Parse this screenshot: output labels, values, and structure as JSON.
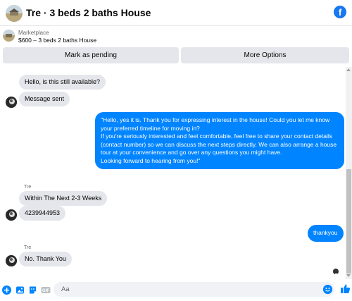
{
  "header": {
    "title": "Tre · 3 beds 2 baths House",
    "brand_icon": "facebook-icon",
    "brand_glyph": "f"
  },
  "marketplace": {
    "label": "Marketplace",
    "item": "$600 – 3 beds 2 baths House",
    "pending_button": "Mark as pending",
    "more_button": "More Options"
  },
  "messages": {
    "m1": "Hello, is this still available?",
    "m2": "Message sent",
    "m3": "\"Hello, yes it is. Thank you for expressing interest in the house! Could you let me know your preferred timeline for moving in?\nIf you're seriously interested and feel comfortable, feel free to share your contact details (contact number) so we can discuss the next steps directly. We can also arrange a house tour at your convenience and go over any questions you might have.\nLooking forward to hearing from you!\"",
    "sender1": "Tre",
    "m4": "Within The Next 2-3 Weeks",
    "m5": "4239944953",
    "m6": "thankyou",
    "sender2": "Tre",
    "m7": "No. Thank You"
  },
  "composer": {
    "placeholder": "Aa",
    "icons": [
      "add-icon",
      "image-icon",
      "sticker-icon",
      "gif-icon",
      "emoji-icon",
      "like-icon"
    ],
    "gif_label": "GIF"
  },
  "colors": {
    "accent": "#0084ff",
    "bubble_incoming": "#e4e6eb",
    "brand": "#1877f2"
  }
}
